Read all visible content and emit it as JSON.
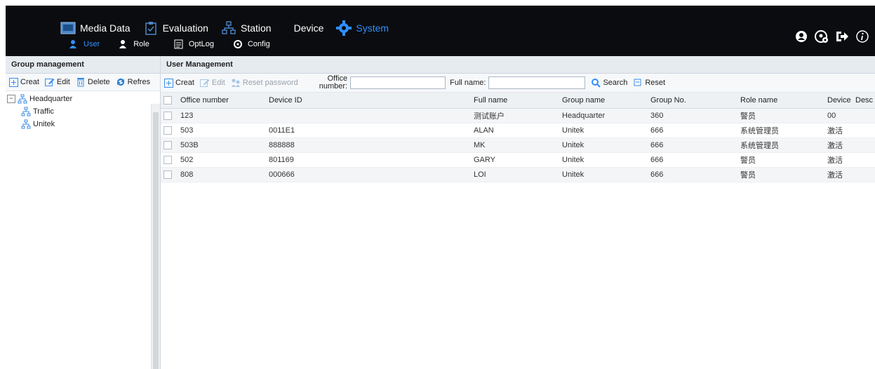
{
  "nav": {
    "main": [
      {
        "label": "Media Data",
        "icon": "media-data-icon"
      },
      {
        "label": "Evaluation",
        "icon": "evaluation-icon"
      },
      {
        "label": "Station",
        "icon": "station-icon"
      },
      {
        "label": "Device",
        "icon": ""
      },
      {
        "label": "System",
        "icon": "gear-icon",
        "active": true
      }
    ],
    "sub": [
      {
        "label": "User",
        "icon": "user-icon",
        "active": true
      },
      {
        "label": "Role",
        "icon": "role-icon"
      },
      {
        "label": "OptLog",
        "icon": "log-icon"
      },
      {
        "label": "Config",
        "icon": "config-icon"
      }
    ],
    "right_icons": [
      "account-icon",
      "admin-settings-icon",
      "logout-icon",
      "info-icon"
    ]
  },
  "left": {
    "title": "Group management",
    "toolbar": {
      "create": "Creat",
      "edit": "Edit",
      "delete": "Delete",
      "refresh": "Refres"
    },
    "tree": {
      "root": "Headquarter",
      "children": [
        "Traffic",
        "Unitek"
      ]
    }
  },
  "right": {
    "title": "User Management",
    "toolbar": {
      "create": "Creat",
      "edit": "Edit",
      "reset_password": "Reset password",
      "office_label_1": "Office",
      "office_label_2": "number:",
      "office_value": "",
      "fullname_label": "Full name:",
      "fullname_value": "",
      "search": "Search",
      "reset": "Reset"
    },
    "columns": [
      "Office number",
      "Device ID",
      "Full name",
      "Group name",
      "Group No.",
      "Role name",
      "Device",
      "Desc"
    ],
    "rows": [
      [
        "123",
        "",
        "测试账户",
        "Headquarter",
        "360",
        "警员",
        "00",
        ""
      ],
      [
        "503",
        "0011E1",
        "ALAN",
        "Unitek",
        "666",
        "系统管理员",
        "激活",
        ""
      ],
      [
        "503B",
        "888888",
        "MK",
        "Unitek",
        "666",
        "系统管理员",
        "激活",
        ""
      ],
      [
        "502",
        "801169",
        "GARY",
        "Unitek",
        "666",
        "警员",
        "激活",
        ""
      ],
      [
        "808",
        "000666",
        "LOI",
        "Unitek",
        "666",
        "警员",
        "激活",
        ""
      ]
    ]
  },
  "colors": {
    "accent": "#2f8fff",
    "topbar": "#0b0c0f",
    "header_bg": "#e6ebf0"
  }
}
